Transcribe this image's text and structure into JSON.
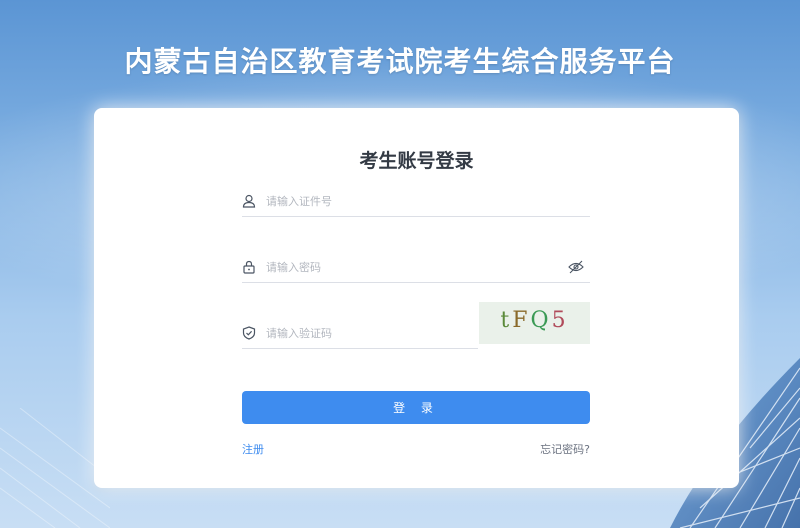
{
  "header": {
    "title": "内蒙古自治区教育考试院考生综合服务平台"
  },
  "login": {
    "title": "考生账号登录",
    "id_field": {
      "placeholder": "请输入证件号",
      "value": "",
      "icon": "user-icon"
    },
    "password_field": {
      "placeholder": "请输入密码",
      "value": "",
      "icon": "lock-icon",
      "toggle_icon": "eye-slash-icon"
    },
    "captcha_field": {
      "placeholder": "请输入验证码",
      "value": "",
      "icon": "shield-check-icon"
    },
    "captcha_image": {
      "chars": [
        "t",
        "F",
        "Q",
        "5"
      ]
    },
    "submit_label": "登 录",
    "register_link": "注册",
    "forgot_link": "忘记密码?"
  },
  "colors": {
    "accent": "#3e8cef",
    "title_text": "#333a44",
    "background_top": "#5b95d4",
    "background_bottom": "#c8def4"
  }
}
